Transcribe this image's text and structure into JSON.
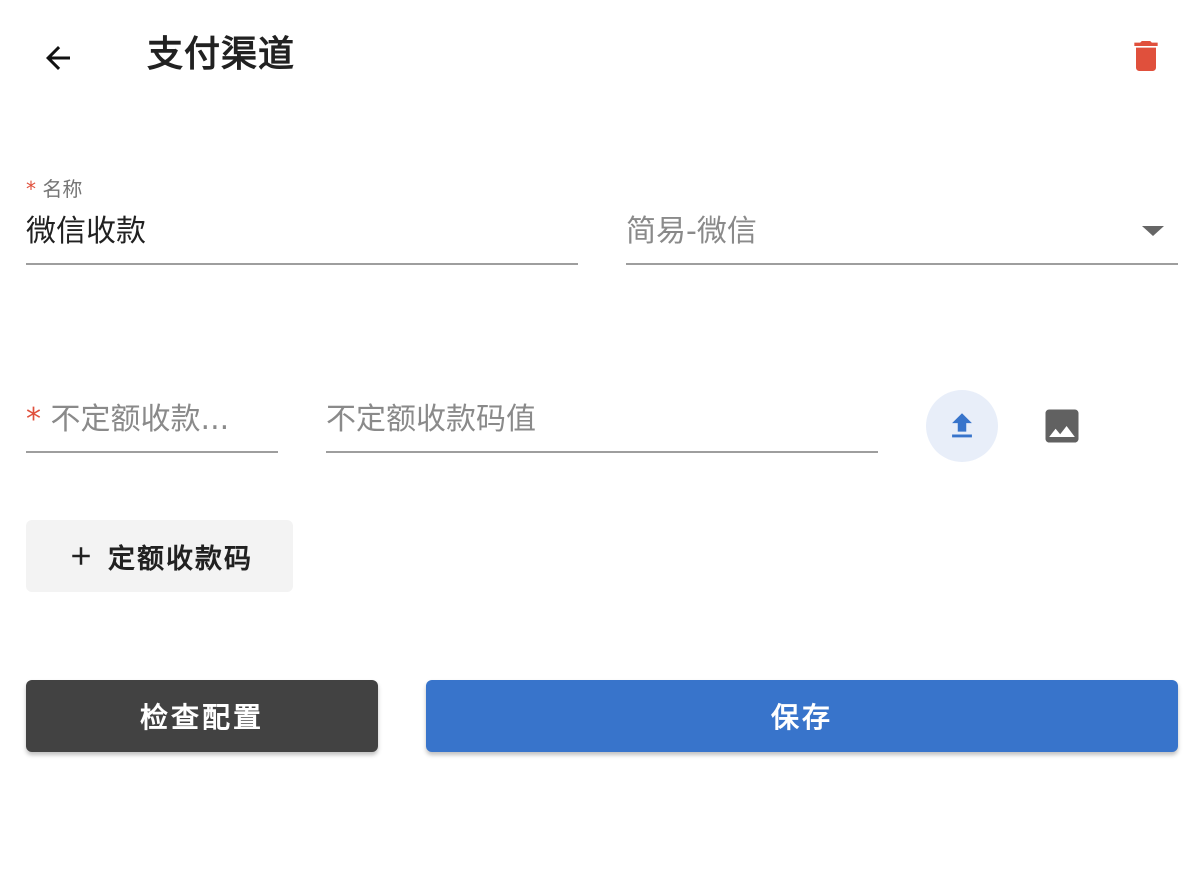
{
  "header": {
    "title": "支付渠道",
    "back_icon": "arrow-left-icon",
    "delete_icon": "trash-icon",
    "delete_color": "#e0503c"
  },
  "form": {
    "name_field": {
      "required_mark": "*",
      "label": "名称",
      "value": "微信收款"
    },
    "type_select": {
      "selected": "简易-微信",
      "icon": "caret-down-icon"
    },
    "code_name_field": {
      "required_mark": "*",
      "placeholder": "不定额收款..."
    },
    "code_value_field": {
      "placeholder": "不定额收款码值"
    },
    "upload_icon": "upload-icon",
    "image_icon": "image-icon",
    "add_fixed_button": {
      "icon": "plus-icon",
      "label": "定额收款码"
    }
  },
  "actions": {
    "check_label": "检查配置",
    "save_label": "保存",
    "check_color": "#424242",
    "save_color": "#3874cb"
  }
}
